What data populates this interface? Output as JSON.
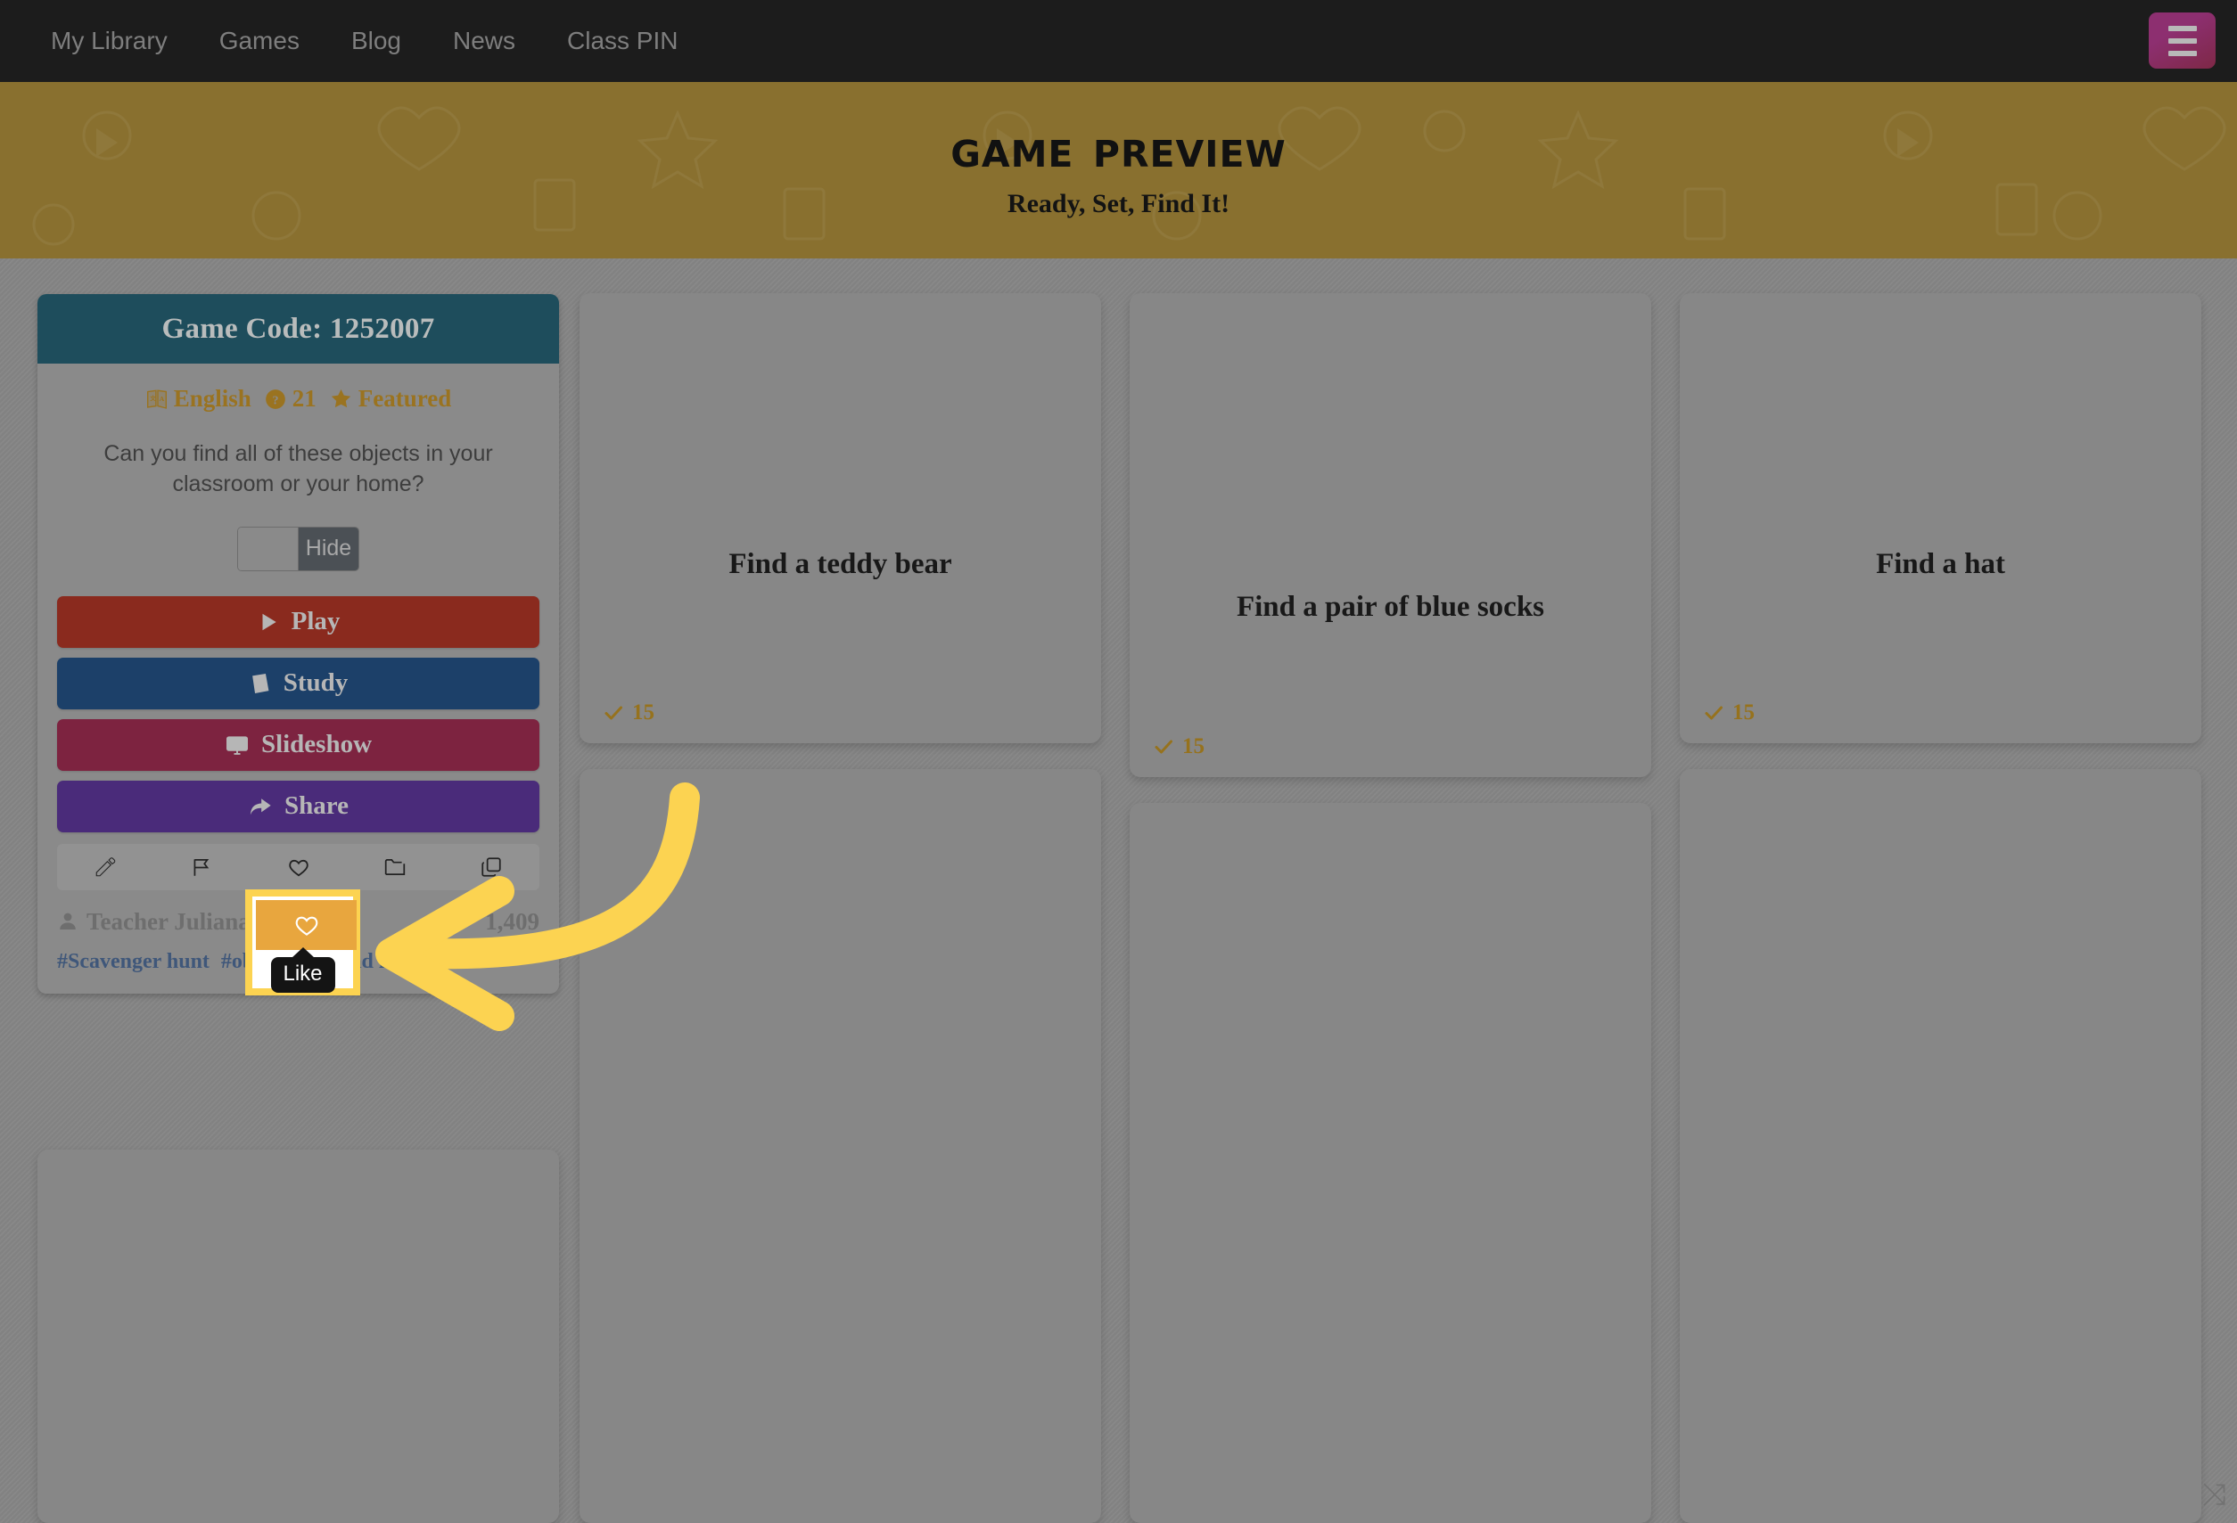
{
  "nav": {
    "links": [
      {
        "label": "My Library"
      },
      {
        "label": "Games"
      },
      {
        "label": "Blog"
      },
      {
        "label": "News"
      },
      {
        "label": "Class PIN"
      }
    ],
    "menu_button_name": "menu"
  },
  "hero": {
    "title": "Game Preview",
    "subtitle": "Ready, Set, Find It!",
    "background_color": "#89702f"
  },
  "info_card": {
    "game_code_label": "Game Code: 1252007",
    "header_color": "#1e4d5c",
    "meta": {
      "language": "English",
      "question_count": "21",
      "featured_label": "Featured"
    },
    "description": "Can you find all of these objects in your classroom or your home?",
    "toggle": {
      "label": "Hide",
      "state": "off"
    },
    "buttons": [
      {
        "label": "Play",
        "icon": "play-icon",
        "color": "#8a2a1e"
      },
      {
        "label": "Study",
        "icon": "book-icon",
        "color": "#1c4069"
      },
      {
        "label": "Slideshow",
        "icon": "monitor-icon",
        "color": "#7d2340"
      },
      {
        "label": "Share",
        "icon": "share-icon",
        "color": "#4a2b7a"
      }
    ],
    "icon_bar": [
      {
        "name": "edit-icon"
      },
      {
        "name": "flag-icon"
      },
      {
        "name": "heart-icon"
      },
      {
        "name": "folder-icon"
      },
      {
        "name": "copy-icon"
      }
    ],
    "author": "Teacher Juliana",
    "play_count": "1,409",
    "tags": [
      "#Scavenger hunt",
      "#object",
      "#go find it"
    ]
  },
  "cards": [
    {
      "title": "Find a teddy bear",
      "count": "15"
    },
    {
      "title": "Find a pair of blue socks",
      "count": "15"
    },
    {
      "title": "Find a hat",
      "count": "15"
    },
    {
      "title": "",
      "count": ""
    },
    {
      "title": "",
      "count": ""
    },
    {
      "title": "",
      "count": ""
    },
    {
      "title": "",
      "count": ""
    }
  ],
  "annotation": {
    "tooltip_label": "Like",
    "highlight_color": "#fcd351",
    "arrow_color": "#fcd351",
    "target": "like-button"
  },
  "corner": {
    "glyph": "⤨"
  }
}
